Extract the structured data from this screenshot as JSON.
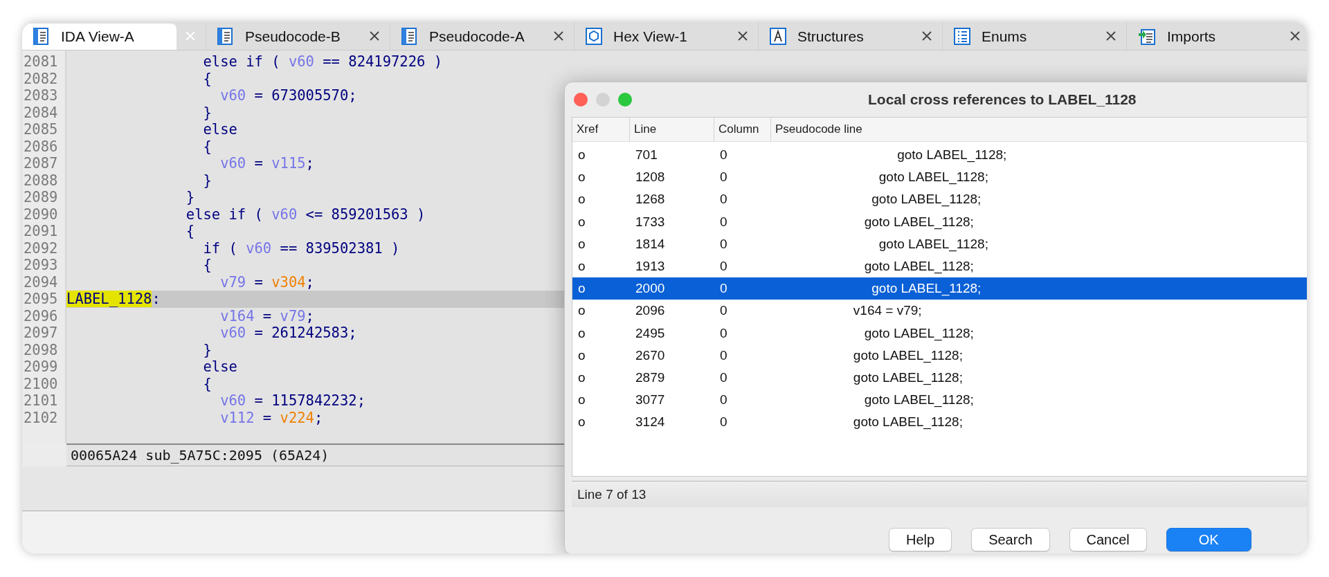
{
  "tabs": [
    {
      "label": "IDA View-A",
      "kind": "doc",
      "selected": true
    },
    {
      "label": "Pseudocode-B",
      "kind": "doc",
      "selected": false
    },
    {
      "label": "Pseudocode-A",
      "kind": "doc",
      "selected": false
    },
    {
      "label": "Hex View-1",
      "kind": "hex",
      "selected": false
    },
    {
      "label": "Structures",
      "kind": "struct",
      "selected": false
    },
    {
      "label": "Enums",
      "kind": "enum",
      "selected": false
    },
    {
      "label": "Imports",
      "kind": "imports",
      "selected": false
    }
  ],
  "code_view": {
    "lines": [
      {
        "number": "2081",
        "current": false,
        "tokens": [
          {
            "text": "                else if ( ",
            "kind": "text"
          },
          {
            "text": "v60",
            "kind": "var"
          },
          {
            "text": " == 824197226 )",
            "kind": "text"
          }
        ]
      },
      {
        "number": "2082",
        "current": false,
        "tokens": [
          {
            "text": "                {",
            "kind": "text"
          }
        ]
      },
      {
        "number": "2083",
        "current": false,
        "tokens": [
          {
            "text": "                  v60",
            "kind": "var"
          },
          {
            "text": " = 673005570;",
            "kind": "text"
          }
        ]
      },
      {
        "number": "2084",
        "current": false,
        "tokens": [
          {
            "text": "                }",
            "kind": "text"
          }
        ]
      },
      {
        "number": "2085",
        "current": false,
        "tokens": [
          {
            "text": "                else",
            "kind": "text"
          }
        ]
      },
      {
        "number": "2086",
        "current": false,
        "tokens": [
          {
            "text": "                {",
            "kind": "text"
          }
        ]
      },
      {
        "number": "2087",
        "current": false,
        "tokens": [
          {
            "text": "                  v60",
            "kind": "var"
          },
          {
            "text": " = ",
            "kind": "text"
          },
          {
            "text": "v115",
            "kind": "var"
          },
          {
            "text": ";",
            "kind": "text"
          }
        ]
      },
      {
        "number": "2088",
        "current": false,
        "tokens": [
          {
            "text": "                }",
            "kind": "text"
          }
        ]
      },
      {
        "number": "2089",
        "current": false,
        "tokens": [
          {
            "text": "              }",
            "kind": "text"
          }
        ]
      },
      {
        "number": "2090",
        "current": false,
        "tokens": [
          {
            "text": "              else if ( ",
            "kind": "text"
          },
          {
            "text": "v60",
            "kind": "var"
          },
          {
            "text": " <= 859201563 )",
            "kind": "text"
          }
        ]
      },
      {
        "number": "2091",
        "current": false,
        "tokens": [
          {
            "text": "              {",
            "kind": "text"
          }
        ]
      },
      {
        "number": "2092",
        "current": false,
        "tokens": [
          {
            "text": "                if ( ",
            "kind": "text"
          },
          {
            "text": "v60",
            "kind": "var"
          },
          {
            "text": " == 839502381 )",
            "kind": "text"
          }
        ]
      },
      {
        "number": "2093",
        "current": false,
        "tokens": [
          {
            "text": "                {",
            "kind": "text"
          }
        ]
      },
      {
        "number": "2094",
        "current": false,
        "tokens": [
          {
            "text": "                  v79",
            "kind": "var"
          },
          {
            "text": " = ",
            "kind": "text"
          },
          {
            "text": "v304",
            "kind": "global"
          },
          {
            "text": ";",
            "kind": "text"
          }
        ]
      },
      {
        "number": "2095",
        "current": true,
        "tokens": [
          {
            "text": "LABEL_1128",
            "kind": "label"
          },
          {
            "text": ":",
            "kind": "text"
          }
        ]
      },
      {
        "number": "2096",
        "current": false,
        "tokens": [
          {
            "text": "                  v164",
            "kind": "var"
          },
          {
            "text": " = ",
            "kind": "text"
          },
          {
            "text": "v79",
            "kind": "var"
          },
          {
            "text": ";",
            "kind": "text"
          }
        ]
      },
      {
        "number": "2097",
        "current": false,
        "tokens": [
          {
            "text": "                  v60",
            "kind": "var"
          },
          {
            "text": " = 261242583;",
            "kind": "text"
          }
        ]
      },
      {
        "number": "2098",
        "current": false,
        "tokens": [
          {
            "text": "                }",
            "kind": "text"
          }
        ]
      },
      {
        "number": "2099",
        "current": false,
        "tokens": [
          {
            "text": "                else",
            "kind": "text"
          }
        ]
      },
      {
        "number": "2100",
        "current": false,
        "tokens": [
          {
            "text": "                {",
            "kind": "text"
          }
        ]
      },
      {
        "number": "2101",
        "current": false,
        "tokens": [
          {
            "text": "                  v60",
            "kind": "var"
          },
          {
            "text": " = 1157842232;",
            "kind": "text"
          }
        ]
      },
      {
        "number": "2102",
        "current": false,
        "tokens": [
          {
            "text": "                  v112",
            "kind": "var"
          },
          {
            "text": " = ",
            "kind": "text"
          },
          {
            "text": "v224",
            "kind": "global"
          },
          {
            "text": ";",
            "kind": "text"
          }
        ]
      }
    ],
    "status": "00065A24 sub_5A75C:2095 (65A24)"
  },
  "dialog": {
    "title": "Local cross references to LABEL_1128",
    "columns": [
      "Xref",
      "Line",
      "Column",
      "Pseudocode line"
    ],
    "rows": [
      {
        "xref": "o",
        "line": "701",
        "column": "0",
        "code": "                                 goto LABEL_1128;",
        "selected": false
      },
      {
        "xref": "o",
        "line": "1208",
        "column": "0",
        "code": "                            goto LABEL_1128;",
        "selected": false
      },
      {
        "xref": "o",
        "line": "1268",
        "column": "0",
        "code": "                          goto LABEL_1128;",
        "selected": false
      },
      {
        "xref": "o",
        "line": "1733",
        "column": "0",
        "code": "                        goto LABEL_1128;",
        "selected": false
      },
      {
        "xref": "o",
        "line": "1814",
        "column": "0",
        "code": "                            goto LABEL_1128;",
        "selected": false
      },
      {
        "xref": "o",
        "line": "1913",
        "column": "0",
        "code": "                        goto LABEL_1128;",
        "selected": false
      },
      {
        "xref": "o",
        "line": "2000",
        "column": "0",
        "code": "                          goto LABEL_1128;",
        "selected": true
      },
      {
        "xref": "o",
        "line": "2096",
        "column": "0",
        "code": "                     v164 = v79;",
        "selected": false
      },
      {
        "xref": "o",
        "line": "2495",
        "column": "0",
        "code": "                        goto LABEL_1128;",
        "selected": false
      },
      {
        "xref": "o",
        "line": "2670",
        "column": "0",
        "code": "                     goto LABEL_1128;",
        "selected": false
      },
      {
        "xref": "o",
        "line": "2879",
        "column": "0",
        "code": "                     goto LABEL_1128;",
        "selected": false
      },
      {
        "xref": "o",
        "line": "3077",
        "column": "0",
        "code": "                        goto LABEL_1128;",
        "selected": false
      },
      {
        "xref": "o",
        "line": "3124",
        "column": "0",
        "code": "                     goto LABEL_1128;",
        "selected": false
      }
    ],
    "status": "Line 7 of 13",
    "buttons": [
      {
        "label": "Help",
        "default": false
      },
      {
        "label": "Search",
        "default": false
      },
      {
        "label": "Cancel",
        "default": false
      },
      {
        "label": "OK",
        "default": true
      }
    ]
  }
}
